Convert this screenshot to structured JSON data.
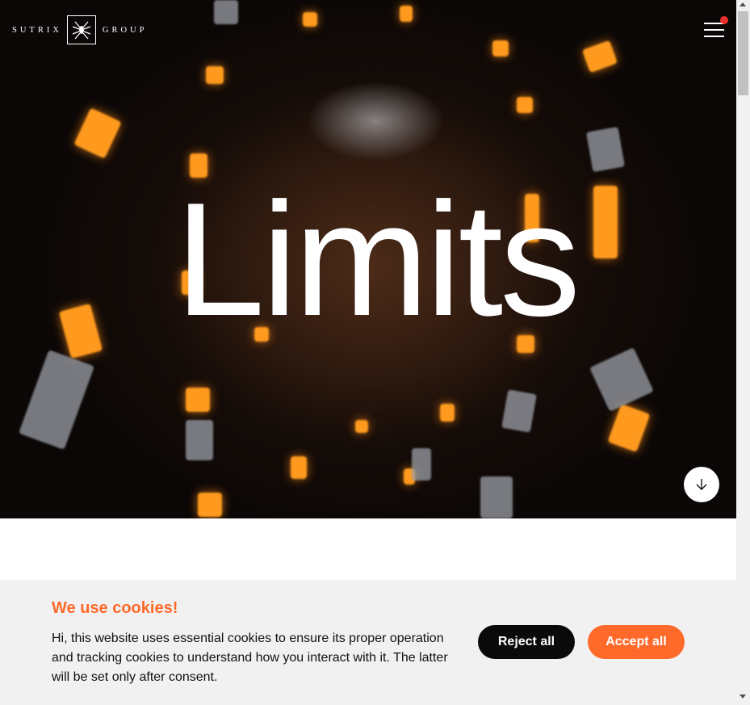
{
  "brand": {
    "left_word": "SUTRIX",
    "right_word": "GROUP"
  },
  "header": {
    "menu_icon": "hamburger-menu-icon",
    "notification_color": "#f0322c"
  },
  "hero": {
    "headline": "Limits",
    "scroll_icon": "arrow-down-icon"
  },
  "cookie_banner": {
    "title": "We use cookies!",
    "text": "Hi, this website uses essential cookies to ensure its proper operation and tracking cookies to understand how you interact with it. The latter will be set only after consent.",
    "reject_label": "Reject all",
    "accept_label": "Accept all"
  },
  "colors": {
    "accent": "#ff6a2b",
    "dark_button": "#0a0a0a",
    "banner_bg": "#f1f1f1"
  }
}
